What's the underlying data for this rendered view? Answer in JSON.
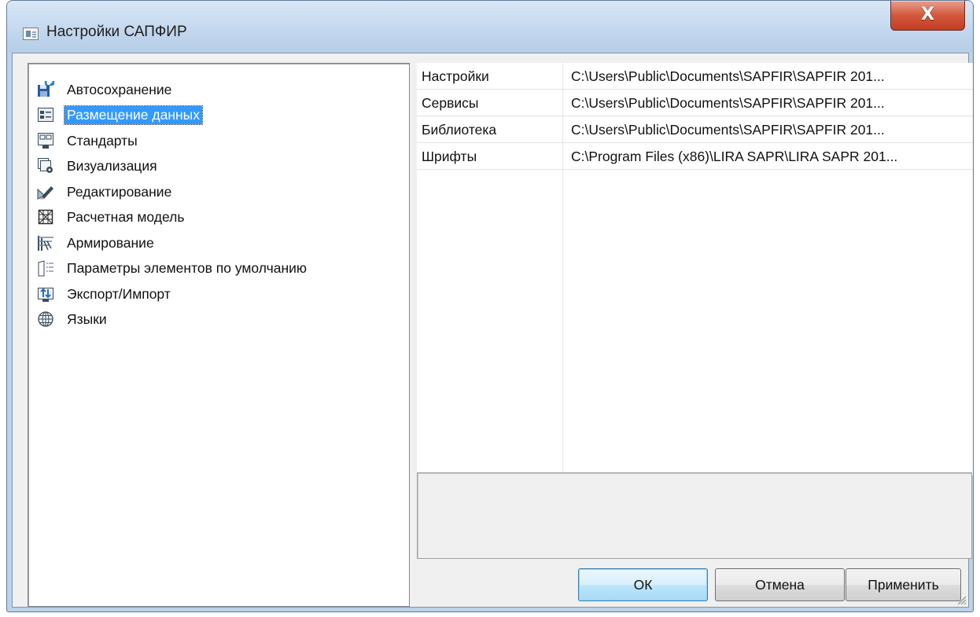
{
  "window": {
    "title": "Настройки САПФИР",
    "close_glyph": "X"
  },
  "tree": {
    "selected_index": 1,
    "items": [
      {
        "label": "Автосохранение",
        "icon": "autosave-icon"
      },
      {
        "label": "Размещение данных",
        "icon": "data-location-icon"
      },
      {
        "label": "Стандарты",
        "icon": "standards-icon"
      },
      {
        "label": "Визуализация",
        "icon": "visualization-icon"
      },
      {
        "label": "Редактирование",
        "icon": "editing-icon"
      },
      {
        "label": "Расчетная модель",
        "icon": "calc-model-icon"
      },
      {
        "label": "Армирование",
        "icon": "reinforcement-icon"
      },
      {
        "label": "Параметры элементов по умолчанию",
        "icon": "default-params-icon"
      },
      {
        "label": "Экспорт/Импорт",
        "icon": "export-import-icon"
      },
      {
        "label": "Языки",
        "icon": "globe-icon"
      }
    ]
  },
  "paths": {
    "rows": [
      {
        "name": "Настройки",
        "value": "C:\\Users\\Public\\Documents\\SAPFIR\\SAPFIR 201..."
      },
      {
        "name": "Сервисы",
        "value": "C:\\Users\\Public\\Documents\\SAPFIR\\SAPFIR 201..."
      },
      {
        "name": "Библиотека",
        "value": "C:\\Users\\Public\\Documents\\SAPFIR\\SAPFIR 201..."
      },
      {
        "name": "Шрифты",
        "value": "C:\\Program Files (x86)\\LIRA SAPR\\LIRA SAPR 201..."
      }
    ]
  },
  "buttons": {
    "ok": "ОК",
    "cancel": "Отмена",
    "apply": "Применить"
  },
  "colors": {
    "selection": "#3399ff",
    "close_button": "#c23e22"
  }
}
